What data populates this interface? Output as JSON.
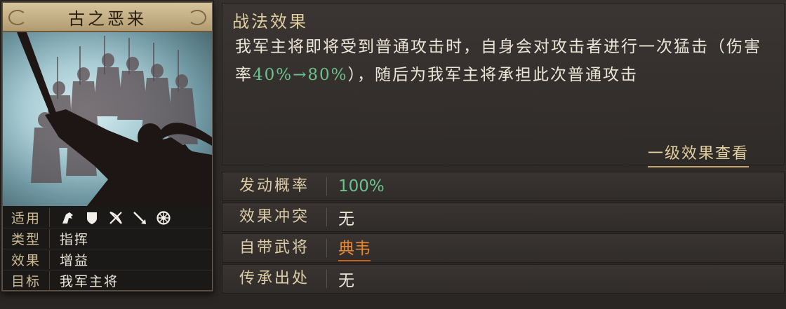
{
  "card": {
    "title": "古之恶来",
    "rows": [
      {
        "key": "适用",
        "icons": [
          "cavalry-icon",
          "shield-icon",
          "crossbow-icon",
          "spear-icon",
          "siege-icon"
        ]
      },
      {
        "key": "类型",
        "value": "指挥"
      },
      {
        "key": "效果",
        "value": "增益"
      },
      {
        "key": "目标",
        "value": "我军主将"
      }
    ]
  },
  "effect": {
    "title": "战法效果",
    "desc_part1": "我军主将即将受到普通攻击时，自身会对攻击者进行一次猛击（伤害率",
    "desc_highlight": "40%→80%",
    "desc_part2": "），随后为我军主将承担此次普通攻击",
    "level_link": "一级效果查看"
  },
  "attributes": [
    {
      "key": "发动概率",
      "value": "100%"
    },
    {
      "key": "效果冲突",
      "value": "无"
    },
    {
      "key": "自带武将",
      "value": "典韦"
    },
    {
      "key": "传承出处",
      "value": "无"
    }
  ],
  "colors": {
    "highlight_green": "#6cc28c",
    "general_orange": "#e8872f",
    "gold": "#e2cf9f"
  }
}
